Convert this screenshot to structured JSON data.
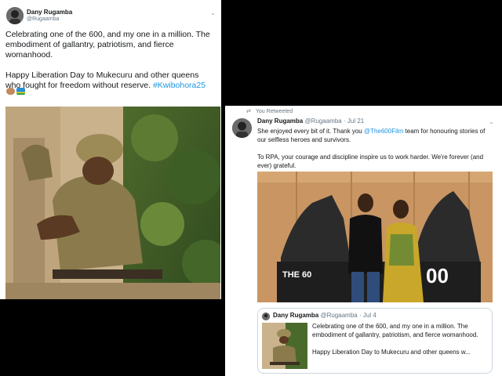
{
  "left_tweet": {
    "name": "Dany Rugamba",
    "handle": "@Rugaamba",
    "line1": "Celebrating one of the 600, and my one in a million. The",
    "line2": "embodiment of gallantry, patriotism, and fierce",
    "line3": "womanhood.",
    "line4": "Happy Liberation Day to Mukecuru and other queens",
    "line5_text": "who fought for freedom without reserve. ",
    "line5_hashtag": "#Kwibohora25",
    "emojis": [
      "woman-emoji",
      "rwanda-flag-emoji"
    ]
  },
  "right_tweet": {
    "retweet_label": "You Retweeted",
    "name": "Dany Rugamba",
    "handle": "@Rugaamba",
    "date": "Jul 21",
    "p1_a": "She enjoyed every bit of it. Thank you ",
    "p1_mention": "@The600Film",
    "p1_b": " team for honouring stories of our selfless heroes and survivors.",
    "p2": "To RPA, your courage and discipline inspire us to work harder. We're forever (and ever) grateful.",
    "photo_text_left": "THE 60",
    "photo_text_right": "00",
    "quote": {
      "name": "Dany Rugamba",
      "handle": "@Rugaamba",
      "date": "Jul 4",
      "p1": "Celebrating one of the 600, and my one in a million. The embodiment of gallantry, patriotism, and fierce womanhood.",
      "p2": "Happy Liberation Day to Mukecuru and other queens w..."
    }
  },
  "separator": "·",
  "colors": {
    "link": "#1b95e0",
    "muted": "#657786",
    "background": "#000000"
  }
}
